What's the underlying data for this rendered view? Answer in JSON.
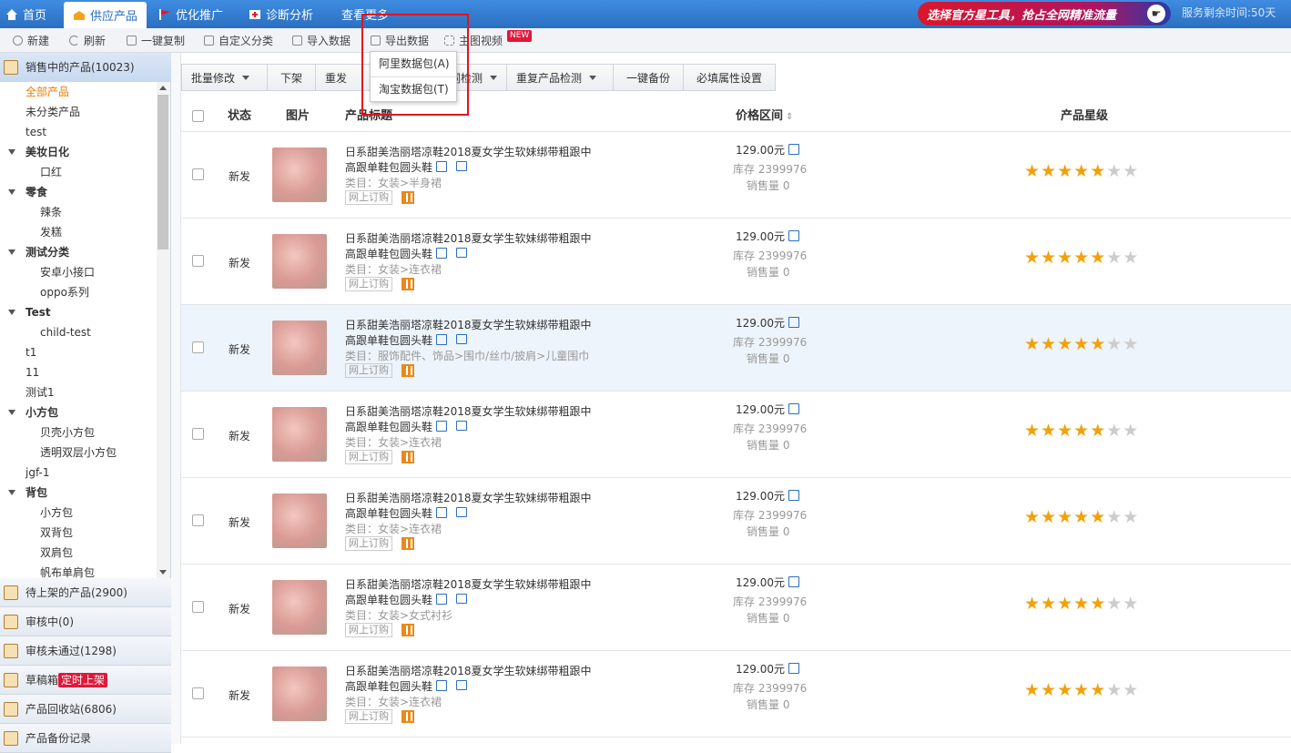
{
  "nav": {
    "tabs": [
      {
        "label": "首页",
        "icon": "home-icon"
      },
      {
        "label": "供应产品",
        "icon": "product-icon"
      },
      {
        "label": "优化推广",
        "icon": "flag-icon"
      },
      {
        "label": "诊断分析",
        "icon": "medkit-icon"
      },
      {
        "label": "查看更多",
        "icon": ""
      }
    ],
    "banner": "选择官方星工具，抢占全网精准流量",
    "service_time": "服务剩余时间:50天"
  },
  "toolbar": {
    "items": [
      "新建",
      "刷新",
      "一键复制",
      "自定义分类",
      "导入数据",
      "导出数据",
      "主图视频"
    ],
    "new_badge": "NEW"
  },
  "export_menu": {
    "items": [
      "阿里数据包(A)",
      "淘宝数据包(T)"
    ]
  },
  "sidebar": {
    "sections": [
      "销售中的产品(10023)",
      "待上架的产品(2900)",
      "审核中(0)",
      "审核未通过(1298)",
      "草稿箱",
      "产品回收站(6806)",
      "产品备份记录"
    ],
    "draft_badge": "定时上架",
    "tree": [
      "全部产品",
      "未分类产品",
      "test",
      "美妆日化",
      "口红",
      "零食",
      "辣条",
      "发糕",
      "测试分类",
      "安卓小接口",
      "oppo系列",
      "Test",
      "child-test",
      "t1",
      "11",
      "测试1",
      "小方包",
      "贝壳小方包",
      "透明双层小方包",
      "jgf-1",
      "背包",
      "小方包",
      "双背包",
      "双肩包",
      "帆布单肩包"
    ]
  },
  "actions": [
    "批量修改",
    "下架",
    "重发",
    "违禁词检测",
    "重复产品检测",
    "一键备份",
    "必填属性设置"
  ],
  "table": {
    "headers": {
      "status": "状态",
      "image": "图片",
      "title": "产品标题",
      "price": "价格区间",
      "stars": "产品星级"
    },
    "rows": [
      {
        "status": "新发",
        "title1": "日系甜美浩丽塔凉鞋2018夏女学生软妹绑带粗跟中",
        "title2": "高跟单鞋包圆头鞋",
        "category": "类目：女装>半身裙",
        "order": "网上订购",
        "price": "129.00元",
        "stock": "库存 2399976",
        "sales": "销售量 0",
        "stars": 5
      },
      {
        "status": "新发",
        "title1": "日系甜美浩丽塔凉鞋2018夏女学生软妹绑带粗跟中",
        "title2": "高跟单鞋包圆头鞋",
        "category": "类目：女装>连衣裙",
        "order": "网上订购",
        "price": "129.00元",
        "stock": "库存 2399976",
        "sales": "销售量 0",
        "stars": 5
      },
      {
        "status": "新发",
        "title1": "日系甜美浩丽塔凉鞋2018夏女学生软妹绑带粗跟中",
        "title2": "高跟单鞋包圆头鞋",
        "category": "类目：服饰配件、饰品>围巾/丝巾/披肩>儿童围巾",
        "order": "网上订购",
        "price": "129.00元",
        "stock": "库存 2399976",
        "sales": "销售量 0",
        "stars": 5
      },
      {
        "status": "新发",
        "title1": "日系甜美浩丽塔凉鞋2018夏女学生软妹绑带粗跟中",
        "title2": "高跟单鞋包圆头鞋",
        "category": "类目：女装>连衣裙",
        "order": "网上订购",
        "price": "129.00元",
        "stock": "库存 2399976",
        "sales": "销售量 0",
        "stars": 5
      },
      {
        "status": "新发",
        "title1": "日系甜美浩丽塔凉鞋2018夏女学生软妹绑带粗跟中",
        "title2": "高跟单鞋包圆头鞋",
        "category": "类目：女装>连衣裙",
        "order": "网上订购",
        "price": "129.00元",
        "stock": "库存 2399976",
        "sales": "销售量 0",
        "stars": 5
      },
      {
        "status": "新发",
        "title1": "日系甜美浩丽塔凉鞋2018夏女学生软妹绑带粗跟中",
        "title2": "高跟单鞋包圆头鞋",
        "category": "类目：女装>女式衬衫",
        "order": "网上订购",
        "price": "129.00元",
        "stock": "库存 2399976",
        "sales": "销售量 0",
        "stars": 5
      },
      {
        "status": "新发",
        "title1": "日系甜美浩丽塔凉鞋2018夏女学生软妹绑带粗跟中",
        "title2": "高跟单鞋包圆头鞋",
        "category": "类目：女装>连衣裙",
        "order": "网上订购",
        "price": "129.00元",
        "stock": "库存 2399976",
        "sales": "销售量 0",
        "stars": 5
      }
    ]
  }
}
